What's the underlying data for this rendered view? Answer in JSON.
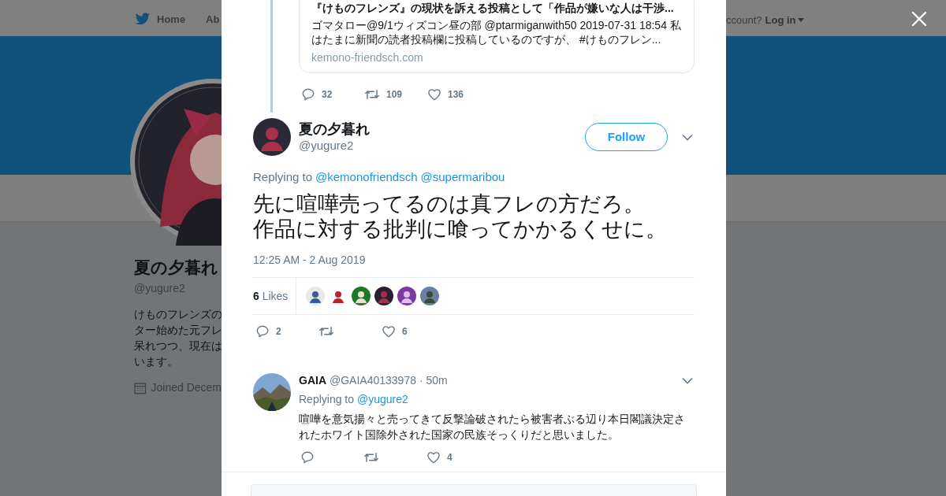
{
  "background_page": {
    "nav": {
      "items": [
        {
          "label": "Home",
          "kind": "home"
        },
        {
          "label": "Ab",
          "kind": "plain"
        }
      ],
      "login_prompt": "ccount?",
      "login": "Log in"
    },
    "profile": {
      "name": "夏の夕暮れ",
      "handle": "@yugure2",
      "bio_lines": [
        "けものフレンズの",
        "ター始めた元フレ",
        "呆れつつ、現在は",
        "います。"
      ],
      "joined": "Joined Decem"
    }
  },
  "modal": {
    "quoted_card": {
      "title": "『けものフレンズ』の現状を訴える投稿として「作品が嫌いな人は干渉...",
      "description_lines": [
        "ゴマタロー@9/1ウィズコン昼の部 @ptarmiganwith50 2019-07-31 18:54 私",
        "はたまに新聞の読者投稿欄に投稿しているのですが、 #けものフレン..."
      ],
      "domain": "kemono-friendsch.com"
    },
    "parent_actions": {
      "replies": "32",
      "retweets": "109",
      "likes": "136"
    },
    "tweet": {
      "name": "夏の夕暮れ",
      "handle": "@yugure2",
      "follow": "Follow",
      "replying_label": "Replying to",
      "replying_to": [
        "@kemonofriendsch",
        "@supermaribou"
      ],
      "text_lines": [
        "先に喧嘩売ってるのは真フレの方だろ。",
        "作品に対する批判に喰ってかかるくせに。"
      ],
      "timestamp": "12:25 AM - 2 Aug 2019",
      "likes_count": "6",
      "likes_label": "Likes",
      "likers": [
        {
          "kind": "avatar"
        },
        {
          "kind": "avatar"
        },
        {
          "kind": "avatar"
        },
        {
          "kind": "avatar"
        },
        {
          "kind": "avatar"
        },
        {
          "kind": "avatar"
        }
      ],
      "actions": {
        "replies": "2",
        "likes": "6"
      }
    },
    "reply": {
      "name": "GAIA",
      "handle": "@GAIA40133978",
      "time": "· 50m",
      "replying_label": "Replying to",
      "replying_to": "@yugure2",
      "text": "喧嘩を意気揚々と売ってきて反撃論破されたら被害者ぶる辺り本日閣議決定されたホワイト国除外された国家の民族そっくりだと思いました。",
      "actions": {
        "likes": "4"
      }
    }
  }
}
